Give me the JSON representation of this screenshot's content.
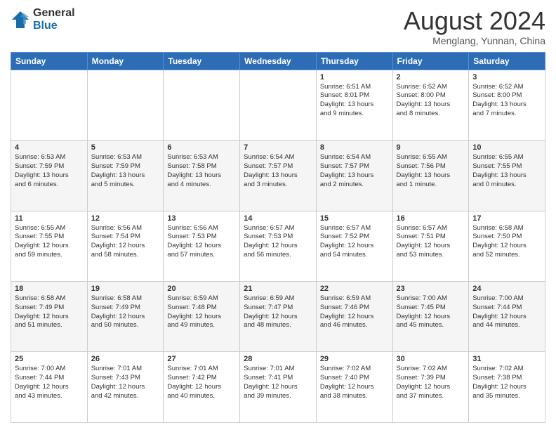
{
  "logo": {
    "general": "General",
    "blue": "Blue"
  },
  "title": "August 2024",
  "subtitle": "Menglang, Yunnan, China",
  "days_of_week": [
    "Sunday",
    "Monday",
    "Tuesday",
    "Wednesday",
    "Thursday",
    "Friday",
    "Saturday"
  ],
  "weeks": [
    [
      {
        "day": "",
        "detail": ""
      },
      {
        "day": "",
        "detail": ""
      },
      {
        "day": "",
        "detail": ""
      },
      {
        "day": "",
        "detail": ""
      },
      {
        "day": "1",
        "detail": "Sunrise: 6:51 AM\nSunset: 8:01 PM\nDaylight: 13 hours\nand 9 minutes."
      },
      {
        "day": "2",
        "detail": "Sunrise: 6:52 AM\nSunset: 8:00 PM\nDaylight: 13 hours\nand 8 minutes."
      },
      {
        "day": "3",
        "detail": "Sunrise: 6:52 AM\nSunset: 8:00 PM\nDaylight: 13 hours\nand 7 minutes."
      }
    ],
    [
      {
        "day": "4",
        "detail": "Sunrise: 6:53 AM\nSunset: 7:59 PM\nDaylight: 13 hours\nand 6 minutes."
      },
      {
        "day": "5",
        "detail": "Sunrise: 6:53 AM\nSunset: 7:59 PM\nDaylight: 13 hours\nand 5 minutes."
      },
      {
        "day": "6",
        "detail": "Sunrise: 6:53 AM\nSunset: 7:58 PM\nDaylight: 13 hours\nand 4 minutes."
      },
      {
        "day": "7",
        "detail": "Sunrise: 6:54 AM\nSunset: 7:57 PM\nDaylight: 13 hours\nand 3 minutes."
      },
      {
        "day": "8",
        "detail": "Sunrise: 6:54 AM\nSunset: 7:57 PM\nDaylight: 13 hours\nand 2 minutes."
      },
      {
        "day": "9",
        "detail": "Sunrise: 6:55 AM\nSunset: 7:56 PM\nDaylight: 13 hours\nand 1 minute."
      },
      {
        "day": "10",
        "detail": "Sunrise: 6:55 AM\nSunset: 7:55 PM\nDaylight: 13 hours\nand 0 minutes."
      }
    ],
    [
      {
        "day": "11",
        "detail": "Sunrise: 6:55 AM\nSunset: 7:55 PM\nDaylight: 12 hours\nand 59 minutes."
      },
      {
        "day": "12",
        "detail": "Sunrise: 6:56 AM\nSunset: 7:54 PM\nDaylight: 12 hours\nand 58 minutes."
      },
      {
        "day": "13",
        "detail": "Sunrise: 6:56 AM\nSunset: 7:53 PM\nDaylight: 12 hours\nand 57 minutes."
      },
      {
        "day": "14",
        "detail": "Sunrise: 6:57 AM\nSunset: 7:53 PM\nDaylight: 12 hours\nand 56 minutes."
      },
      {
        "day": "15",
        "detail": "Sunrise: 6:57 AM\nSunset: 7:52 PM\nDaylight: 12 hours\nand 54 minutes."
      },
      {
        "day": "16",
        "detail": "Sunrise: 6:57 AM\nSunset: 7:51 PM\nDaylight: 12 hours\nand 53 minutes."
      },
      {
        "day": "17",
        "detail": "Sunrise: 6:58 AM\nSunset: 7:50 PM\nDaylight: 12 hours\nand 52 minutes."
      }
    ],
    [
      {
        "day": "18",
        "detail": "Sunrise: 6:58 AM\nSunset: 7:49 PM\nDaylight: 12 hours\nand 51 minutes."
      },
      {
        "day": "19",
        "detail": "Sunrise: 6:58 AM\nSunset: 7:49 PM\nDaylight: 12 hours\nand 50 minutes."
      },
      {
        "day": "20",
        "detail": "Sunrise: 6:59 AM\nSunset: 7:48 PM\nDaylight: 12 hours\nand 49 minutes."
      },
      {
        "day": "21",
        "detail": "Sunrise: 6:59 AM\nSunset: 7:47 PM\nDaylight: 12 hours\nand 48 minutes."
      },
      {
        "day": "22",
        "detail": "Sunrise: 6:59 AM\nSunset: 7:46 PM\nDaylight: 12 hours\nand 46 minutes."
      },
      {
        "day": "23",
        "detail": "Sunrise: 7:00 AM\nSunset: 7:45 PM\nDaylight: 12 hours\nand 45 minutes."
      },
      {
        "day": "24",
        "detail": "Sunrise: 7:00 AM\nSunset: 7:44 PM\nDaylight: 12 hours\nand 44 minutes."
      }
    ],
    [
      {
        "day": "25",
        "detail": "Sunrise: 7:00 AM\nSunset: 7:44 PM\nDaylight: 12 hours\nand 43 minutes."
      },
      {
        "day": "26",
        "detail": "Sunrise: 7:01 AM\nSunset: 7:43 PM\nDaylight: 12 hours\nand 42 minutes."
      },
      {
        "day": "27",
        "detail": "Sunrise: 7:01 AM\nSunset: 7:42 PM\nDaylight: 12 hours\nand 40 minutes."
      },
      {
        "day": "28",
        "detail": "Sunrise: 7:01 AM\nSunset: 7:41 PM\nDaylight: 12 hours\nand 39 minutes."
      },
      {
        "day": "29",
        "detail": "Sunrise: 7:02 AM\nSunset: 7:40 PM\nDaylight: 12 hours\nand 38 minutes."
      },
      {
        "day": "30",
        "detail": "Sunrise: 7:02 AM\nSunset: 7:39 PM\nDaylight: 12 hours\nand 37 minutes."
      },
      {
        "day": "31",
        "detail": "Sunrise: 7:02 AM\nSunset: 7:38 PM\nDaylight: 12 hours\nand 35 minutes."
      }
    ]
  ]
}
